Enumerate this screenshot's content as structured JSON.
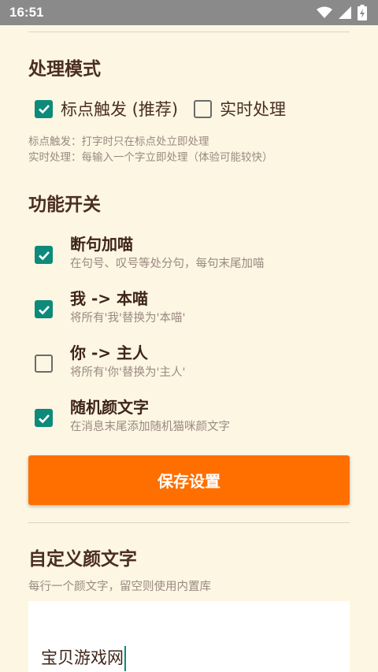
{
  "status_bar": {
    "time": "16:51",
    "icons": [
      "wifi-icon",
      "signal-icon",
      "battery-charging-icon"
    ]
  },
  "mode_section": {
    "title": "处理模式",
    "options": [
      {
        "label": "标点触发 (推荐)",
        "checked": true
      },
      {
        "label": "实时处理",
        "checked": false
      }
    ],
    "hint_lines": [
      "标点触发：打字时只在标点处立即处理",
      "实时处理：每输入一个字立即处理（体验可能较快）"
    ]
  },
  "feature_section": {
    "title": "功能开关",
    "items": [
      {
        "title": "断句加喵",
        "desc": "在句号、叹号等处分句，每句末尾加喵",
        "checked": true
      },
      {
        "title": "我 -> 本喵",
        "desc": "将所有'我'替换为'本喵'",
        "checked": true
      },
      {
        "title": "你 -> 主人",
        "desc": "将所有'你'替换为'主人'",
        "checked": false
      },
      {
        "title": "随机颜文字",
        "desc": "在消息末尾添加随机猫咪颜文字",
        "checked": true
      }
    ]
  },
  "save_button": {
    "label": "保存设置"
  },
  "custom_section": {
    "title": "自定义颜文字",
    "hint": "每行一个颜文字，留空则使用内置库",
    "input_value": "宝贝游戏网"
  },
  "colors": {
    "accent": "#FF6F00",
    "check": "#0E8A7A",
    "background": "#FDF6E3"
  }
}
